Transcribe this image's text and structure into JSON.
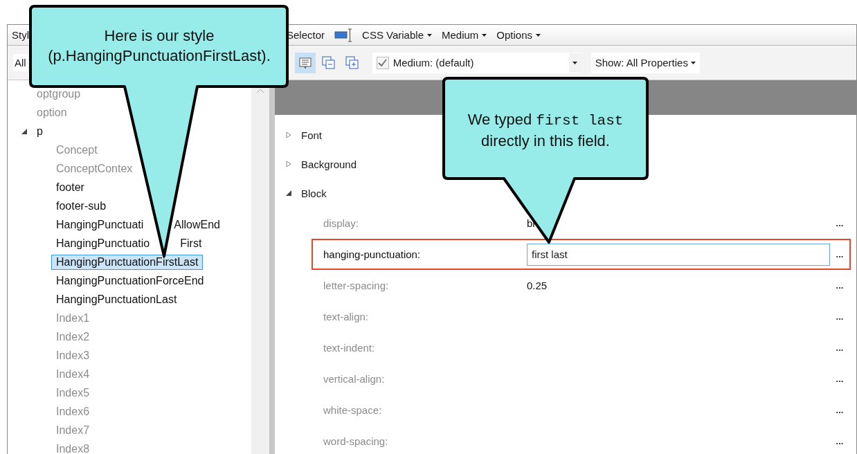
{
  "toolbar": {
    "items": [
      {
        "kind": "text",
        "label": "Styl"
      },
      {
        "kind": "text",
        "label": "Selector"
      },
      {
        "kind": "icon"
      },
      {
        "kind": "menu",
        "label": "CSS Variable"
      },
      {
        "kind": "menu",
        "label": "Medium"
      },
      {
        "kind": "menu",
        "label": "Options"
      }
    ]
  },
  "filter_bar": {
    "filter": "All",
    "buttons": [
      {
        "selected": true
      },
      {
        "selected": false
      },
      {
        "selected": false
      }
    ],
    "medium": {
      "checked": true,
      "label": "Medium: (default)"
    },
    "show": "Show: All Properties"
  },
  "tree": [
    {
      "label": "optgroup",
      "dimmed": true
    },
    {
      "label": "option",
      "dimmed": true
    },
    {
      "label": "p",
      "dimmed": false,
      "expanded": true,
      "children": [
        {
          "label": "Concept",
          "dimmed": true,
          "selected": false
        },
        {
          "label": "ConceptContex",
          "dimmed": true,
          "selected": false
        },
        {
          "label": "footer",
          "dimmed": false,
          "selected": false
        },
        {
          "label": "footer-sub",
          "dimmed": false,
          "selected": false
        },
        {
          "label": "HangingPunctuati",
          "label_rest": "AllowEnd",
          "dimmed": false,
          "selected": false
        },
        {
          "label": "HangingPunctuatio",
          "label_rest": "First",
          "dimmed": false,
          "selected": false
        },
        {
          "label": "HangingPunctuationFirstLast",
          "dimmed": false,
          "selected": true
        },
        {
          "label": "HangingPunctuationForceEnd",
          "dimmed": false,
          "selected": false
        },
        {
          "label": "HangingPunctuationLast",
          "dimmed": false,
          "selected": false
        },
        {
          "label": "Index1",
          "dimmed": true,
          "selected": false
        },
        {
          "label": "Index2",
          "dimmed": true,
          "selected": false
        },
        {
          "label": "Index3",
          "dimmed": true,
          "selected": false
        },
        {
          "label": "Index4",
          "dimmed": true,
          "selected": false
        },
        {
          "label": "Index5",
          "dimmed": true,
          "selected": false
        },
        {
          "label": "Index6",
          "dimmed": true,
          "selected": false
        },
        {
          "label": "Index7",
          "dimmed": true,
          "selected": false
        },
        {
          "label": "Index8",
          "dimmed": true,
          "selected": false
        }
      ]
    }
  ],
  "groups": [
    {
      "label": "Font",
      "expanded": false
    },
    {
      "label": "Background",
      "expanded": false
    },
    {
      "label": "Block",
      "expanded": true,
      "properties": [
        {
          "name": "display:",
          "value": "bl",
          "kind": "text",
          "highlighted": false,
          "more": "..."
        },
        {
          "name": "hanging-punctuation:",
          "value": "first last",
          "kind": "input",
          "highlighted": true,
          "more": "..."
        },
        {
          "name": "letter-spacing:",
          "value": "0.25",
          "kind": "text",
          "highlighted": false,
          "more": "..."
        },
        {
          "name": "text-align:",
          "kind": "text",
          "highlighted": false,
          "more": "..."
        },
        {
          "name": "text-indent:",
          "kind": "text",
          "highlighted": false,
          "more": "..."
        },
        {
          "name": "vertical-align:",
          "kind": "text",
          "highlighted": false,
          "more": "..."
        },
        {
          "name": "white-space:",
          "kind": "text",
          "highlighted": false,
          "more": "..."
        },
        {
          "name": "word-spacing:",
          "kind": "text",
          "highlighted": false,
          "more": "..."
        }
      ]
    }
  ],
  "callouts": [
    {
      "lines": [
        "Here is our style",
        "(p.HangingPunctuationFirstLast)."
      ]
    },
    {
      "before": "We typed ",
      "code": "first last",
      "after": " directly in this field."
    }
  ]
}
